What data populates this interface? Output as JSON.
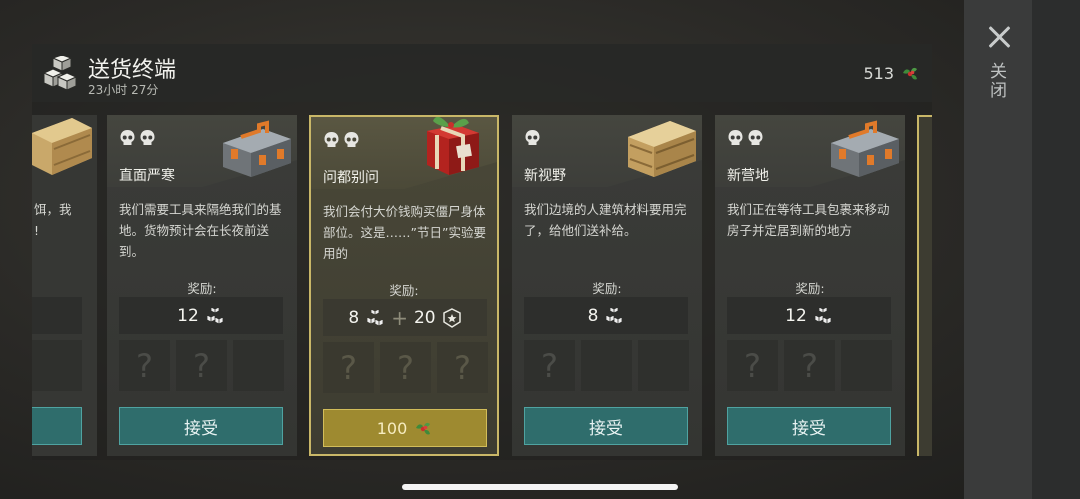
{
  "header": {
    "title": "送货终端",
    "timer": "23小时 27分",
    "currency_amount": "513",
    "close_label": "关闭"
  },
  "partial_left": {
    "desc": "饵，我\n!"
  },
  "cards": [
    {
      "name": "直面严寒",
      "skulls": 2,
      "desc": "我们需要工具来隔绝我们的基地。货物预计会在长夜前送到。",
      "reward_label": "奖励:",
      "reward_value": "12",
      "slots": [
        "?",
        "?",
        ""
      ],
      "button_label": "接受",
      "art": "toolbox-icon"
    },
    {
      "name": "问都别问",
      "skulls": 2,
      "desc": "我们会付大价钱购买僵尸身体部位。这是……”节日”实验要用的",
      "reward_label": "奖励:",
      "reward_value": "8",
      "reward_plus": "+",
      "reward_value_2": "20",
      "slots": [
        "?",
        "?",
        "?"
      ],
      "button_label": "100",
      "art": "gift-box-icon"
    },
    {
      "name": "新视野",
      "skulls": 1,
      "desc": "我们边境的人建筑材料要用完了，给他们送补给。",
      "reward_label": "奖励:",
      "reward_value": "8",
      "slots": [
        "?",
        "",
        ""
      ],
      "button_label": "接受",
      "art": "wooden-crate-icon"
    },
    {
      "name": "新营地",
      "skulls": 2,
      "desc": "我们正在等待工具包裹来移动房子并定居到新的地方",
      "reward_label": "奖励:",
      "reward_value": "12",
      "slots": [
        "?",
        "?",
        ""
      ],
      "button_label": "接受",
      "art": "toolbox-icon"
    }
  ],
  "colors": {
    "accept_button": "#2f6d6c",
    "featured_border": "#c9b768",
    "buy_button": "#9e8a30"
  }
}
